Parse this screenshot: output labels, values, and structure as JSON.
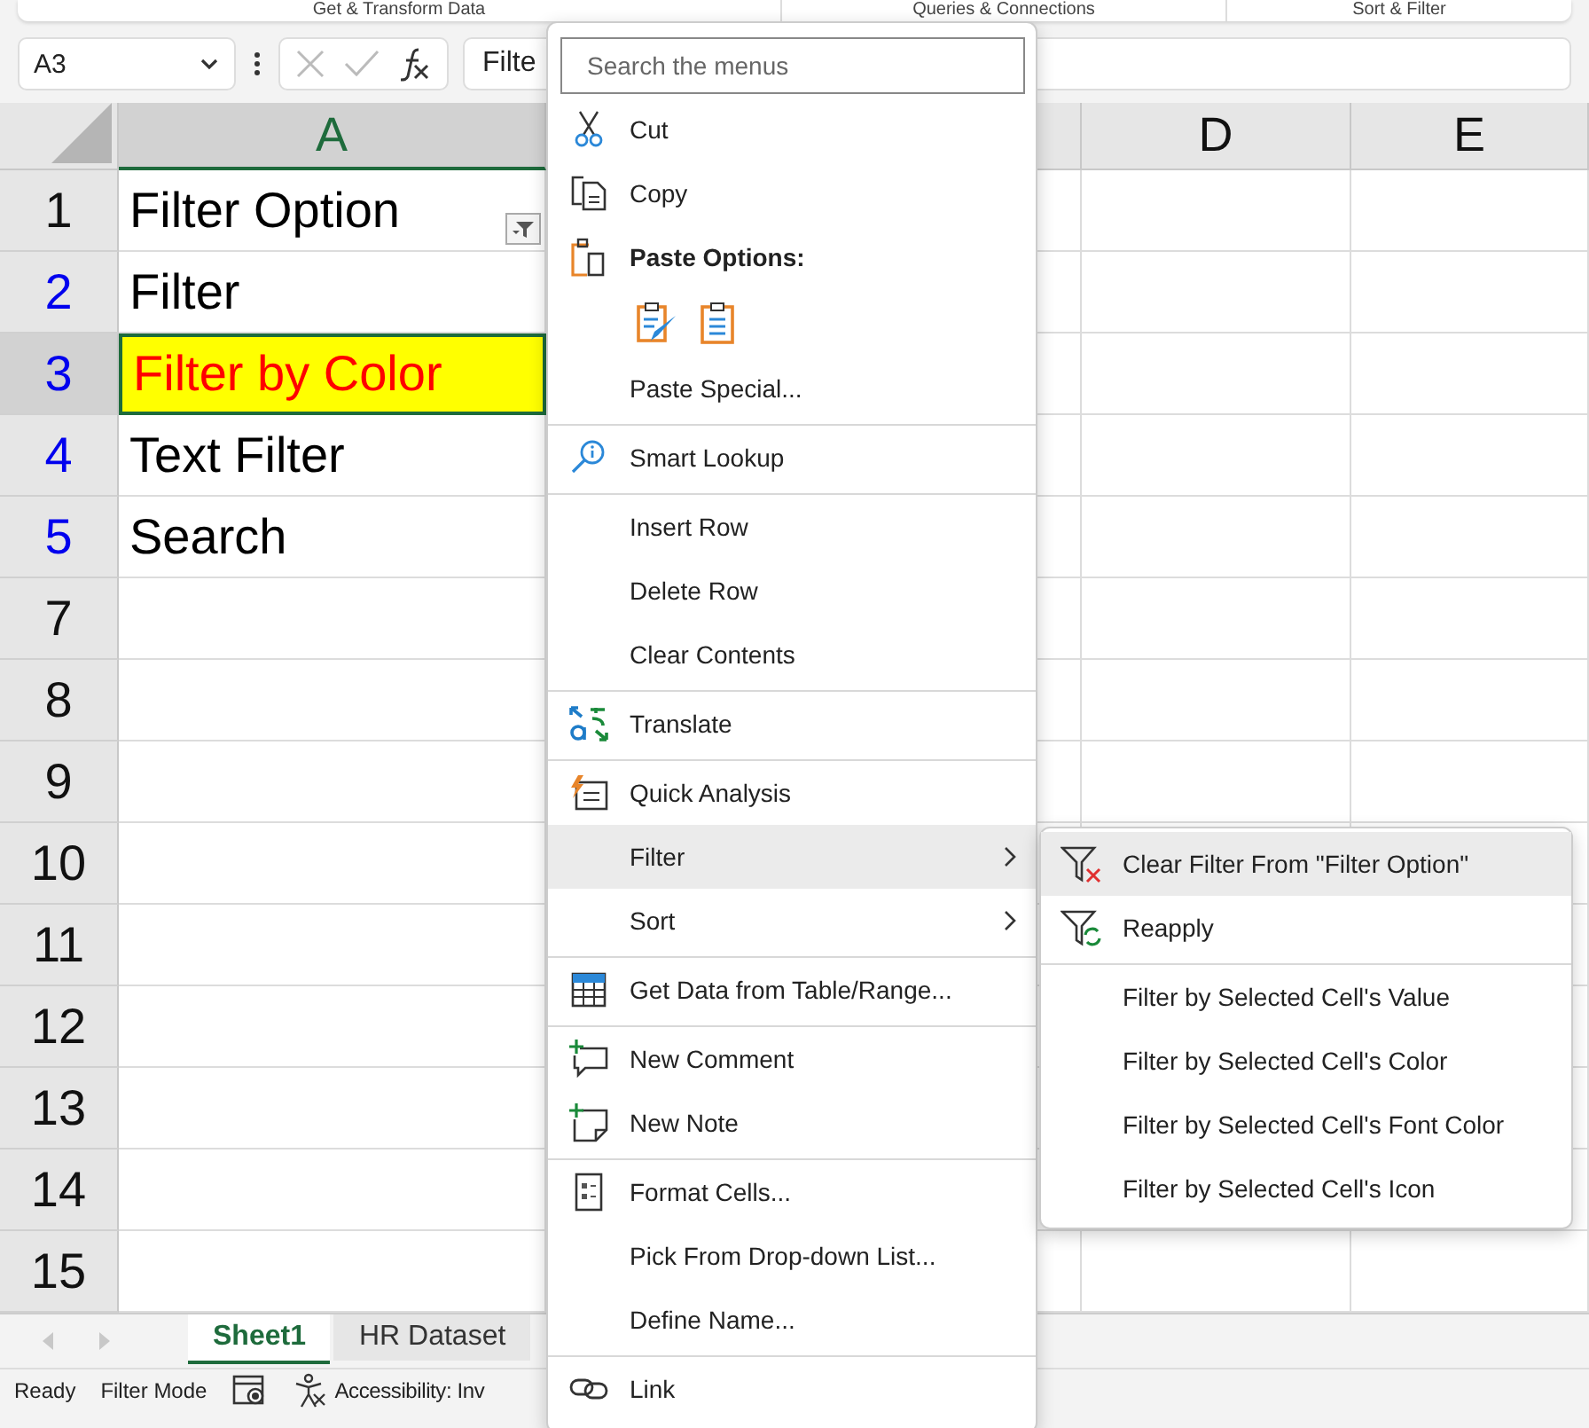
{
  "ribbon_groups": [
    "Get & Transform Data",
    "Queries & Connections",
    "Sort & Filter"
  ],
  "formula_bar": {
    "name_box": "A3",
    "formula": "Filte"
  },
  "columns": [
    {
      "label": "A",
      "selected": true
    },
    {
      "label": "D",
      "selected": false
    },
    {
      "label": "E",
      "selected": false
    }
  ],
  "rows": [
    {
      "number": "1",
      "filtered": false,
      "selected": false,
      "cell_a": "Filter Option",
      "filter_button": true
    },
    {
      "number": "2",
      "filtered": true,
      "selected": false,
      "cell_a": "Filter"
    },
    {
      "number": "3",
      "filtered": true,
      "selected": true,
      "cell_a": "Filter by Color",
      "color": "#ff0000",
      "fill": {
        "color": "#ffff00"
      }
    },
    {
      "number": "4",
      "filtered": true,
      "selected": false,
      "cell_a": "Text Filter"
    },
    {
      "number": "5",
      "filtered": true,
      "selected": false,
      "cell_a": "Search"
    },
    {
      "number": "7",
      "filtered": false,
      "selected": false
    },
    {
      "number": "8",
      "filtered": false,
      "selected": false
    },
    {
      "number": "9",
      "filtered": false,
      "selected": false
    },
    {
      "number": "10",
      "filtered": false,
      "selected": false
    },
    {
      "number": "11",
      "filtered": false,
      "selected": false
    },
    {
      "number": "12",
      "filtered": false,
      "selected": false
    },
    {
      "number": "13",
      "filtered": false,
      "selected": false
    },
    {
      "number": "14",
      "filtered": false,
      "selected": false
    },
    {
      "number": "15",
      "filtered": false,
      "selected": false
    }
  ],
  "sheet_tabs": [
    {
      "label": "Sheet1",
      "selected": true
    },
    {
      "label": "HR Dataset",
      "selected": false
    }
  ],
  "status_bar": {
    "ready": "Ready",
    "mode": "Filter Mode",
    "accessibility": "Accessibility: Inv"
  },
  "context_menu": {
    "search": {
      "placeholder": "Search the menus"
    },
    "items": [
      {
        "kind": "command",
        "label": "Cut",
        "separator_before": false,
        "selected": false
      },
      {
        "kind": "command",
        "label": "Copy",
        "separator_before": false,
        "selected": false
      },
      {
        "kind": "header",
        "label": "Paste Options:",
        "separator_before": false,
        "selected": false
      },
      {
        "kind": "paste_icons",
        "separator_before": false,
        "selected": false
      },
      {
        "kind": "command",
        "label": "Paste Special...",
        "separator_before": false,
        "selected": false
      },
      {
        "kind": "command",
        "label": "Smart Lookup",
        "separator_before": true,
        "selected": false
      },
      {
        "kind": "command",
        "label": "Insert Row",
        "separator_before": true,
        "selected": false
      },
      {
        "kind": "command",
        "label": "Delete Row",
        "separator_before": false,
        "selected": false
      },
      {
        "kind": "command",
        "label": "Clear Contents",
        "separator_before": false,
        "selected": false
      },
      {
        "kind": "command",
        "label": "Translate",
        "separator_before": true,
        "selected": false
      },
      {
        "kind": "command",
        "label": "Quick Analysis",
        "separator_before": true,
        "selected": false
      },
      {
        "kind": "submenu",
        "label": "Filter",
        "separator_before": false,
        "selected": true
      },
      {
        "kind": "submenu",
        "label": "Sort",
        "separator_before": false,
        "selected": false
      },
      {
        "kind": "command",
        "label": "Get Data from Table/Range...",
        "separator_before": true,
        "selected": false
      },
      {
        "kind": "command",
        "label": "New Comment",
        "separator_before": true,
        "selected": false
      },
      {
        "kind": "command",
        "label": "New Note",
        "separator_before": false,
        "selected": false
      },
      {
        "kind": "command",
        "label": "Format Cells...",
        "separator_before": true,
        "selected": false
      },
      {
        "kind": "command",
        "label": "Pick From Drop-down List...",
        "separator_before": false,
        "selected": false
      },
      {
        "kind": "command",
        "label": "Define Name...",
        "separator_before": false,
        "selected": false
      },
      {
        "kind": "command",
        "label": "Link",
        "separator_before": true,
        "selected": false
      }
    ]
  },
  "submenu": {
    "items": [
      {
        "label": "Clear Filter From \"Filter Option\"",
        "separator_before": false,
        "selected": true
      },
      {
        "label": "Reapply",
        "separator_before": false,
        "selected": false
      },
      {
        "label": "Filter by Selected Cell's Value",
        "separator_before": true,
        "selected": false
      },
      {
        "label": "Filter by Selected Cell's Color",
        "separator_before": false,
        "selected": false
      },
      {
        "label": "Filter by Selected Cell's Font Color",
        "separator_before": false,
        "selected": false
      },
      {
        "label": "Filter by Selected Cell's Icon",
        "separator_before": false,
        "selected": false
      }
    ]
  }
}
